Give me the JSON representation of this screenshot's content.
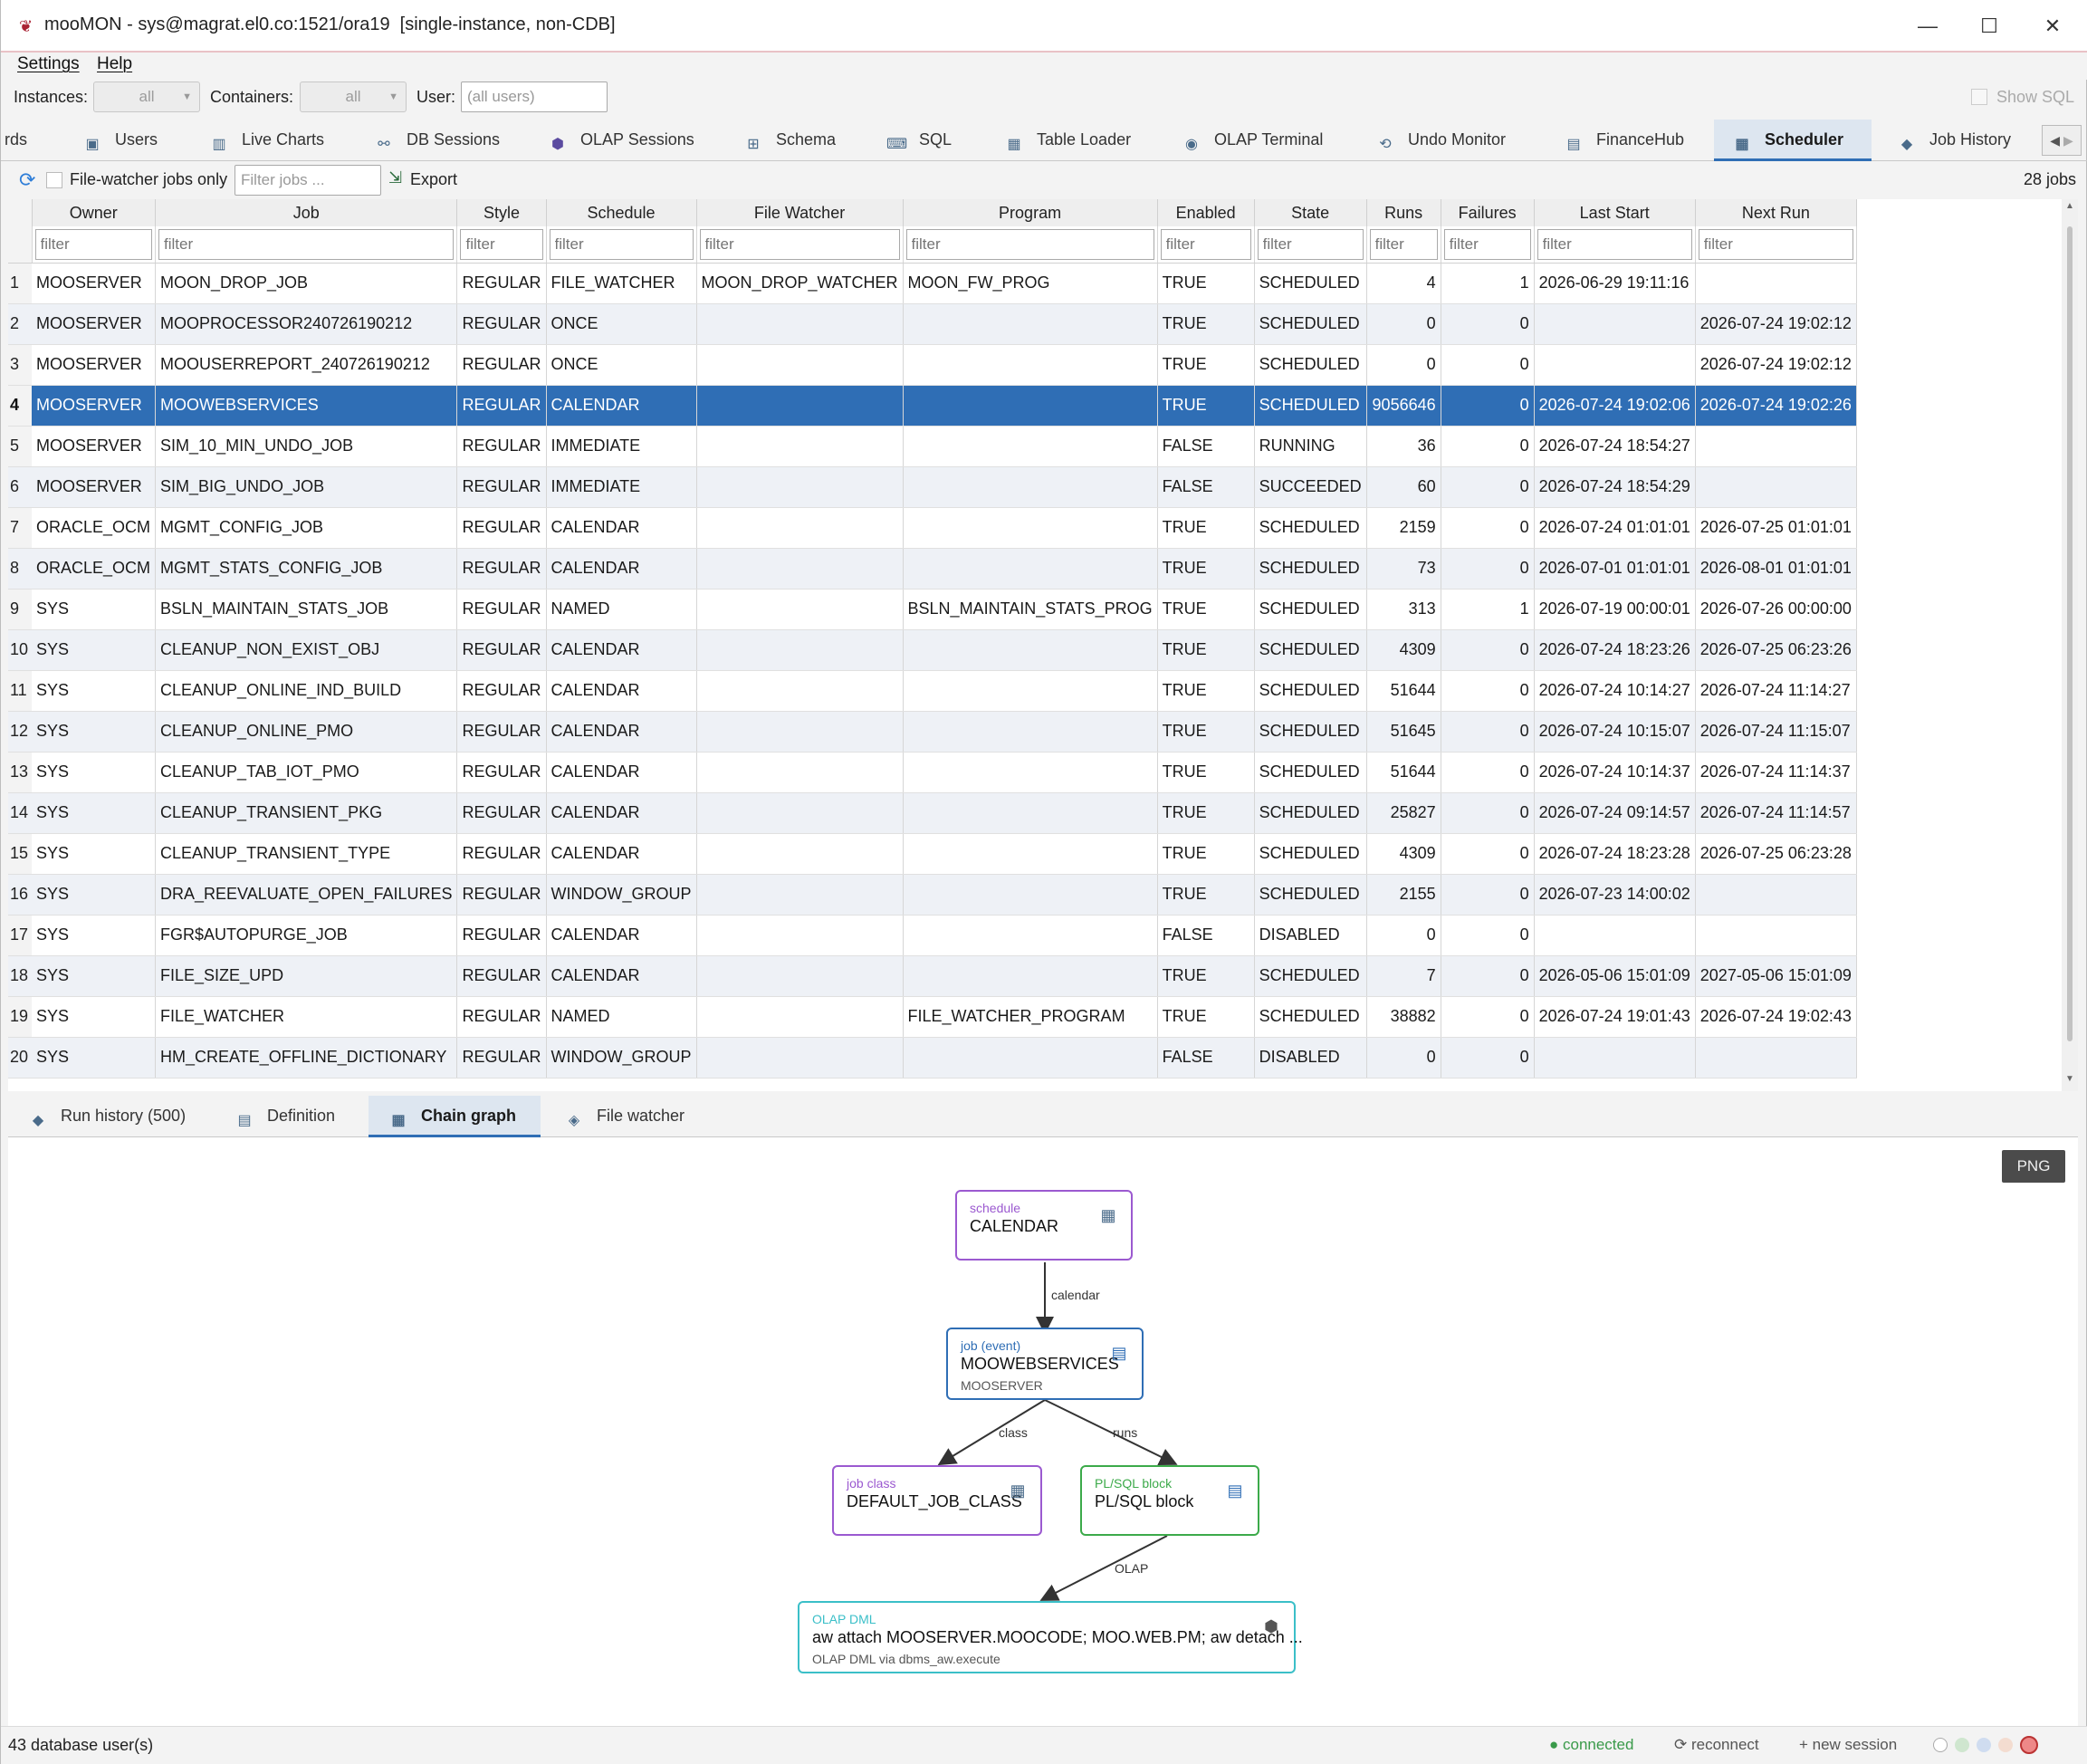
{
  "window": {
    "title": "mooMON - sys@magrat.el0.co:1521/ora19  [single-instance, non-CDB]",
    "minimize": "—",
    "maximize": "☐",
    "close": "✕"
  },
  "menu": [
    "Settings",
    "Help"
  ],
  "filters": {
    "instances_label": "Instances:",
    "instances_value": "all",
    "containers_label": "Containers:",
    "containers_value": "all",
    "user_label": "User:",
    "user_placeholder": "(all users)",
    "show_sql": "Show SQL"
  },
  "tabs": [
    {
      "label": "rds",
      "icon": "dashboard-icon"
    },
    {
      "label": "Users",
      "icon": "users-icon"
    },
    {
      "label": "Live Charts",
      "icon": "chart-icon"
    },
    {
      "label": "DB Sessions",
      "icon": "sessions-icon"
    },
    {
      "label": "OLAP Sessions",
      "icon": "cube-icon"
    },
    {
      "label": "Schema",
      "icon": "schema-icon"
    },
    {
      "label": "SQL",
      "icon": "sql-icon"
    },
    {
      "label": "Table Loader",
      "icon": "table-icon"
    },
    {
      "label": "OLAP Terminal",
      "icon": "terminal-icon"
    },
    {
      "label": "Undo Monitor",
      "icon": "undo-icon"
    },
    {
      "label": "FinanceHub",
      "icon": "finance-icon"
    },
    {
      "label": "Scheduler",
      "icon": "calendar-icon",
      "active": true
    },
    {
      "label": "Job History",
      "icon": "history-icon"
    }
  ],
  "toolbar": {
    "file_watcher_only": "File-watcher jobs only",
    "filter_placeholder": "Filter jobs ...",
    "export": "Export",
    "job_count": "28 jobs"
  },
  "grid": {
    "columns": [
      "Owner",
      "Job",
      "Style",
      "Schedule",
      "File Watcher",
      "Program",
      "Enabled",
      "State",
      "Runs",
      "Failures",
      "Last Start",
      "Next Run"
    ],
    "filter_placeholder": "filter",
    "rows": [
      [
        "MOOSERVER",
        "MOON_DROP_JOB",
        "REGULAR",
        "FILE_WATCHER",
        "MOON_DROP_WATCHER",
        "MOON_FW_PROG",
        "TRUE",
        "SCHEDULED",
        "4",
        "1",
        "2026-06-29 19:11:16",
        ""
      ],
      [
        "MOOSERVER",
        "MOOPROCESSOR240726190212",
        "REGULAR",
        "ONCE",
        "",
        "",
        "TRUE",
        "SCHEDULED",
        "0",
        "0",
        "",
        "2026-07-24 19:02:12"
      ],
      [
        "MOOSERVER",
        "MOOUSERREPORT_240726190212",
        "REGULAR",
        "ONCE",
        "",
        "",
        "TRUE",
        "SCHEDULED",
        "0",
        "0",
        "",
        "2026-07-24 19:02:12"
      ],
      [
        "MOOSERVER",
        "MOOWEBSERVICES",
        "REGULAR",
        "CALENDAR",
        "",
        "",
        "TRUE",
        "SCHEDULED",
        "9056646",
        "0",
        "2026-07-24 19:02:06",
        "2026-07-24 19:02:26"
      ],
      [
        "MOOSERVER",
        "SIM_10_MIN_UNDO_JOB",
        "REGULAR",
        "IMMEDIATE",
        "",
        "",
        "FALSE",
        "RUNNING",
        "36",
        "0",
        "2026-07-24 18:54:27",
        ""
      ],
      [
        "MOOSERVER",
        "SIM_BIG_UNDO_JOB",
        "REGULAR",
        "IMMEDIATE",
        "",
        "",
        "FALSE",
        "SUCCEEDED",
        "60",
        "0",
        "2026-07-24 18:54:29",
        ""
      ],
      [
        "ORACLE_OCM",
        "MGMT_CONFIG_JOB",
        "REGULAR",
        "CALENDAR",
        "",
        "",
        "TRUE",
        "SCHEDULED",
        "2159",
        "0",
        "2026-07-24 01:01:01",
        "2026-07-25 01:01:01"
      ],
      [
        "ORACLE_OCM",
        "MGMT_STATS_CONFIG_JOB",
        "REGULAR",
        "CALENDAR",
        "",
        "",
        "TRUE",
        "SCHEDULED",
        "73",
        "0",
        "2026-07-01 01:01:01",
        "2026-08-01 01:01:01"
      ],
      [
        "SYS",
        "BSLN_MAINTAIN_STATS_JOB",
        "REGULAR",
        "NAMED",
        "",
        "BSLN_MAINTAIN_STATS_PROG",
        "TRUE",
        "SCHEDULED",
        "313",
        "1",
        "2026-07-19 00:00:01",
        "2026-07-26 00:00:00"
      ],
      [
        "SYS",
        "CLEANUP_NON_EXIST_OBJ",
        "REGULAR",
        "CALENDAR",
        "",
        "",
        "TRUE",
        "SCHEDULED",
        "4309",
        "0",
        "2026-07-24 18:23:26",
        "2026-07-25 06:23:26"
      ],
      [
        "SYS",
        "CLEANUP_ONLINE_IND_BUILD",
        "REGULAR",
        "CALENDAR",
        "",
        "",
        "TRUE",
        "SCHEDULED",
        "51644",
        "0",
        "2026-07-24 10:14:27",
        "2026-07-24 11:14:27"
      ],
      [
        "SYS",
        "CLEANUP_ONLINE_PMO",
        "REGULAR",
        "CALENDAR",
        "",
        "",
        "TRUE",
        "SCHEDULED",
        "51645",
        "0",
        "2026-07-24 10:15:07",
        "2026-07-24 11:15:07"
      ],
      [
        "SYS",
        "CLEANUP_TAB_IOT_PMO",
        "REGULAR",
        "CALENDAR",
        "",
        "",
        "TRUE",
        "SCHEDULED",
        "51644",
        "0",
        "2026-07-24 10:14:37",
        "2026-07-24 11:14:37"
      ],
      [
        "SYS",
        "CLEANUP_TRANSIENT_PKG",
        "REGULAR",
        "CALENDAR",
        "",
        "",
        "TRUE",
        "SCHEDULED",
        "25827",
        "0",
        "2026-07-24 09:14:57",
        "2026-07-24 11:14:57"
      ],
      [
        "SYS",
        "CLEANUP_TRANSIENT_TYPE",
        "REGULAR",
        "CALENDAR",
        "",
        "",
        "TRUE",
        "SCHEDULED",
        "4309",
        "0",
        "2026-07-24 18:23:28",
        "2026-07-25 06:23:28"
      ],
      [
        "SYS",
        "DRA_REEVALUATE_OPEN_FAILURES",
        "REGULAR",
        "WINDOW_GROUP",
        "",
        "",
        "TRUE",
        "SCHEDULED",
        "2155",
        "0",
        "2026-07-23 14:00:02",
        ""
      ],
      [
        "SYS",
        "FGR$AUTOPURGE_JOB",
        "REGULAR",
        "CALENDAR",
        "",
        "",
        "FALSE",
        "DISABLED",
        "0",
        "0",
        "",
        ""
      ],
      [
        "SYS",
        "FILE_SIZE_UPD",
        "REGULAR",
        "CALENDAR",
        "",
        "",
        "TRUE",
        "SCHEDULED",
        "7",
        "0",
        "2026-05-06 15:01:09",
        "2027-05-06 15:01:09"
      ],
      [
        "SYS",
        "FILE_WATCHER",
        "REGULAR",
        "NAMED",
        "",
        "FILE_WATCHER_PROGRAM",
        "TRUE",
        "SCHEDULED",
        "38882",
        "0",
        "2026-07-24 19:01:43",
        "2026-07-24 19:02:43"
      ],
      [
        "SYS",
        "HM_CREATE_OFFLINE_DICTIONARY",
        "REGULAR",
        "WINDOW_GROUP",
        "",
        "",
        "FALSE",
        "DISABLED",
        "0",
        "0",
        "",
        ""
      ]
    ],
    "selected_row": 4
  },
  "detail_tabs": [
    {
      "label": "Run history (500)",
      "icon": "history-icon"
    },
    {
      "label": "Definition",
      "icon": "document-icon"
    },
    {
      "label": "Chain graph",
      "icon": "graph-icon",
      "active": true
    },
    {
      "label": "File watcher",
      "icon": "watcher-icon"
    }
  ],
  "graph": {
    "png_button": "PNG",
    "nodes": {
      "schedule": {
        "kind": "schedule",
        "title": "CALENDAR",
        "sub": "",
        "color": "#9b59d0"
      },
      "job": {
        "kind": "job (event)",
        "title": "MOOWEBSERVICES",
        "sub": "MOOSERVER",
        "color": "#2f6eb5"
      },
      "job_class": {
        "kind": "job class",
        "title": "DEFAULT_JOB_CLASS",
        "sub": "",
        "color": "#9b59d0"
      },
      "plsql": {
        "kind": "PL/SQL block",
        "title": "PL/SQL block",
        "sub": "",
        "color": "#3caa4a"
      },
      "olap": {
        "kind": "OLAP DML",
        "title": "aw attach MOOSERVER.MOOCODE; MOO.WEB.PM; aw detach ...",
        "sub": "OLAP DML via dbms_aw.execute",
        "color": "#3bbfc8"
      }
    },
    "edges": {
      "calendar": "calendar",
      "class": "class",
      "runs": "runs",
      "olap": "OLAP"
    }
  },
  "status": {
    "users": "43 database user(s)",
    "connected": "● connected",
    "reconnect": "⟳ reconnect",
    "new_session": "+ new session"
  }
}
